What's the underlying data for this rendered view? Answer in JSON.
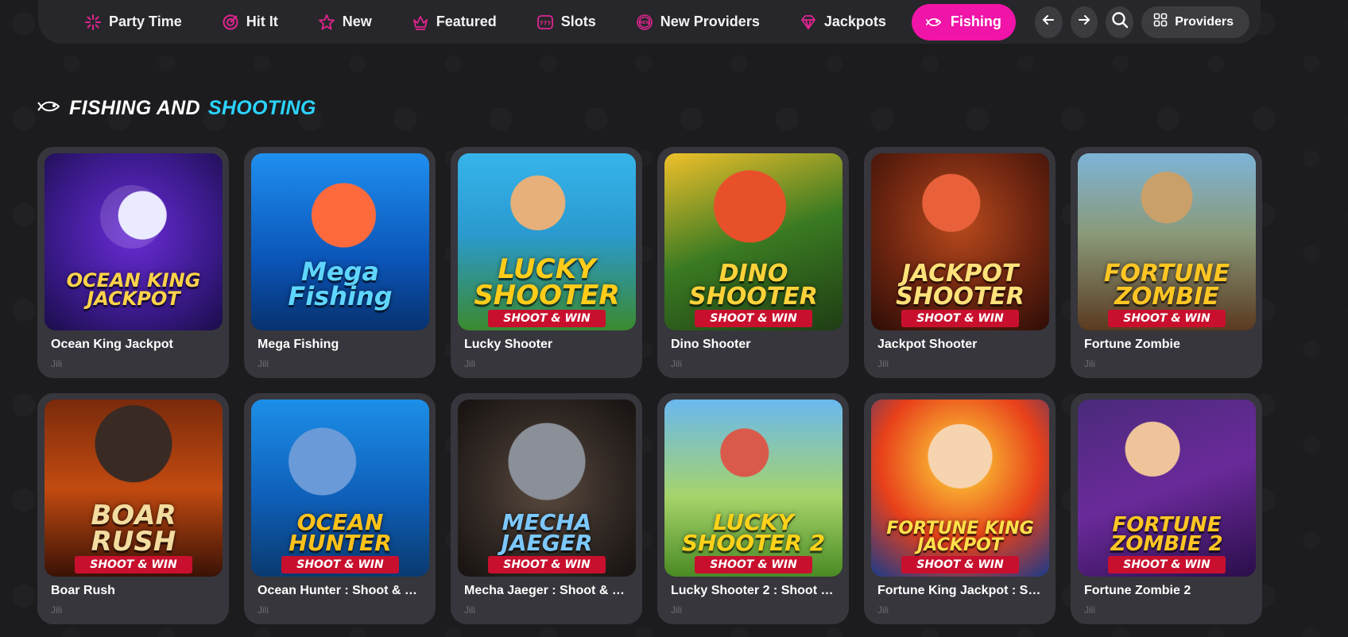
{
  "colors": {
    "accent": "#f014a8",
    "section_highlight": "#2bd3ff",
    "card_bg": "#36363c",
    "page_bg": "#1c1c1f"
  },
  "nav": {
    "items": [
      {
        "label": "Party Time",
        "icon": "firework-icon",
        "active": false
      },
      {
        "label": "Hit It",
        "icon": "target-icon",
        "active": false
      },
      {
        "label": "New",
        "icon": "star-icon",
        "active": false
      },
      {
        "label": "Featured",
        "icon": "crown-icon",
        "active": false
      },
      {
        "label": "Slots",
        "icon": "slot-machine-icon",
        "active": false
      },
      {
        "label": "New Providers",
        "icon": "new-badge-icon",
        "active": false
      },
      {
        "label": "Jackpots",
        "icon": "diamond-icon",
        "active": false
      },
      {
        "label": "Fishing",
        "icon": "fish-icon",
        "active": true
      }
    ],
    "providers_label": "Providers"
  },
  "section": {
    "title_part1": "FISHING AND",
    "title_part2": "SHOOTING",
    "icon": "fish-icon"
  },
  "games": [
    {
      "title": "Ocean King Jackpot",
      "provider": "Jili",
      "logo": "OCEAN KING JACKPOT",
      "tagline": ""
    },
    {
      "title": "Mega Fishing",
      "provider": "Jili",
      "logo": "Mega Fishing",
      "tagline": ""
    },
    {
      "title": "Lucky Shooter",
      "provider": "Jili",
      "logo": "LUCKY SHOOTER",
      "tagline": "SHOOT & WIN"
    },
    {
      "title": "Dino Shooter",
      "provider": "Jili",
      "logo": "DINO SHOOTER",
      "tagline": "SHOOT & WIN"
    },
    {
      "title": "Jackpot Shooter",
      "provider": "Jili",
      "logo": "JACKPOT SHOOTER",
      "tagline": "SHOOT & WIN"
    },
    {
      "title": "Fortune Zombie",
      "provider": "Jili",
      "logo": "FORTUNE ZOMBIE",
      "tagline": "SHOOT & WIN"
    },
    {
      "title": "Boar Rush",
      "provider": "Jili",
      "logo": "BOAR RUSH",
      "tagline": "SHOOT & WIN"
    },
    {
      "title": "Ocean Hunter : Shoot & Win",
      "provider": "Jili",
      "logo": "OCEAN HUNTER",
      "tagline": "SHOOT & WIN"
    },
    {
      "title": "Mecha Jaeger : Shoot & Win",
      "provider": "Jili",
      "logo": "MECHA JAEGER",
      "tagline": "SHOOT & WIN"
    },
    {
      "title": "Lucky Shooter 2 : Shoot &...",
      "provider": "Jili",
      "logo": "LUCKY SHOOTER 2",
      "tagline": "SHOOT & WIN"
    },
    {
      "title": "Fortune King Jackpot : Sh...",
      "provider": "Jili",
      "logo": "FORTUNE KING JACKPOT",
      "tagline": "SHOOT & WIN"
    },
    {
      "title": "Fortune Zombie 2",
      "provider": "Jili",
      "logo": "FORTUNE ZOMBIE 2",
      "tagline": "SHOOT & WIN"
    }
  ]
}
